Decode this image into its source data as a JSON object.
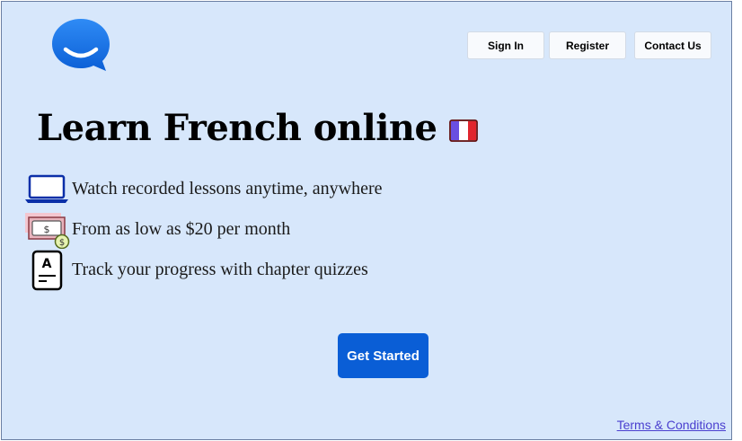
{
  "header": {
    "logo_icon": "chat-bubble-smile-icon",
    "nav": [
      {
        "label": "Sign In"
      },
      {
        "label": "Register"
      },
      {
        "label": "Contact Us"
      }
    ]
  },
  "hero": {
    "title": "Learn French online",
    "flag_icon": "french-flag-icon"
  },
  "features": [
    {
      "icon": "laptop-icon",
      "text": "Watch recorded lessons anytime, anywhere"
    },
    {
      "icon": "money-icon",
      "text": "From as low as $20 per month"
    },
    {
      "icon": "quiz-sheet-icon",
      "text": "Track your progress with chapter quizzes"
    }
  ],
  "cta": {
    "label": "Get Started"
  },
  "footer": {
    "terms_label": "Terms & Conditions"
  },
  "colors": {
    "background": "#d7e7fb",
    "accent": "#0a5ed6",
    "link": "#4a3fcf"
  }
}
